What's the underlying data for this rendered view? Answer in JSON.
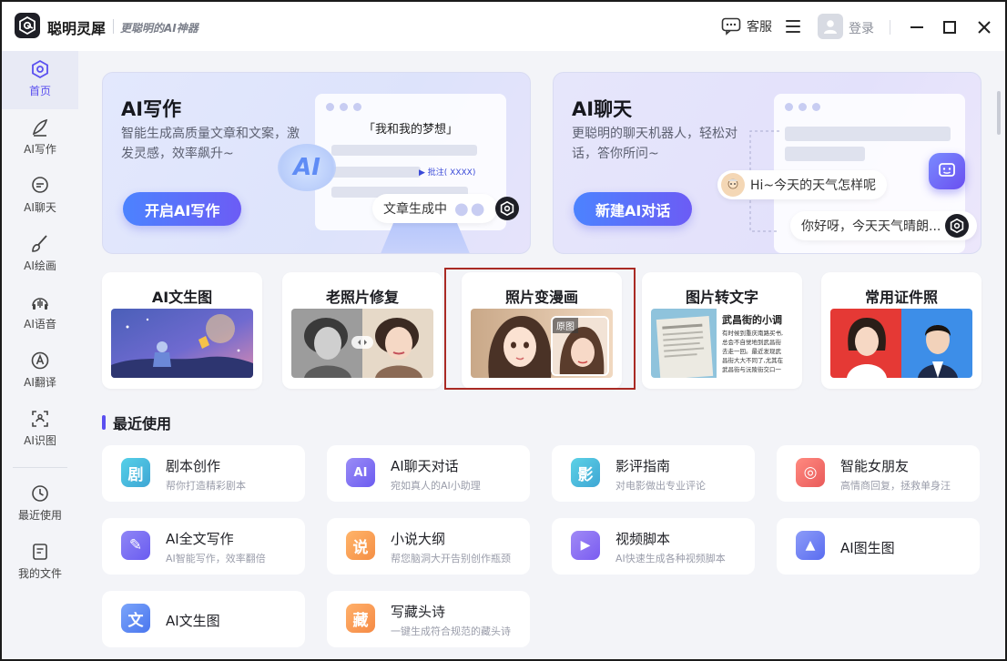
{
  "app": {
    "name": "聪明灵犀",
    "slogan": "更聪明的AI神器",
    "service_label": "客服",
    "login_label": "登录"
  },
  "sidebar": {
    "items": [
      {
        "label": "首页",
        "icon": "home-logo-icon",
        "active": true
      },
      {
        "label": "AI写作",
        "icon": "pen-icon"
      },
      {
        "label": "AI聊天",
        "icon": "chat-icon"
      },
      {
        "label": "AI绘画",
        "icon": "brush-icon"
      },
      {
        "label": "AI语音",
        "icon": "voice-icon"
      },
      {
        "label": "AI翻译",
        "icon": "translate-icon"
      },
      {
        "label": "AI识图",
        "icon": "scan-icon"
      },
      {
        "label": "最近使用",
        "icon": "clock-icon"
      },
      {
        "label": "我的文件",
        "icon": "file-icon"
      }
    ]
  },
  "hero_write": {
    "title": "AI写作",
    "desc": "智能生成高质量文章和文案，激发灵感，效率飙升~",
    "button": "开启AI写作",
    "mock_heading": "「我和我的梦想」",
    "mock_note": "▶ 批注( XXXX)",
    "ai_badge": "AI",
    "status_bubble": "文章生成中"
  },
  "hero_chat": {
    "title": "AI聊天",
    "desc": "更聪明的聊天机器人，轻松对话，答你所问~",
    "button": "新建AI对话",
    "user_bubble": "Hi~今天的天气怎样呢",
    "bot_bubble": "你好呀，今天天气晴朗..."
  },
  "features": [
    {
      "title": "AI文生图"
    },
    {
      "title": "老照片修复"
    },
    {
      "title": "照片变漫画",
      "tag": "原图"
    },
    {
      "title": "图片转文字",
      "book_title": "武昌街的小调",
      "doc_lines": [
        "有时候到重庆南路买书,",
        "总会不自觉地到武昌街",
        "去走一回。最近发现武",
        "昌街大大不同了,尤其在",
        "武昌街与沅陵街交口一"
      ]
    },
    {
      "title": "常用证件照"
    }
  ],
  "recent": {
    "title": "最近使用",
    "items": [
      {
        "title": "剧本创作",
        "sub": "帮你打造精彩剧本",
        "glyph": "剧",
        "color": "#3fb6d8"
      },
      {
        "title": "AI聊天对话",
        "sub": "宛如真人的AI小助理",
        "glyph": "AI",
        "color": "#7b6cf2"
      },
      {
        "title": "影评指南",
        "sub": "对电影做出专业评论",
        "glyph": "影",
        "color": "#3fb2d2"
      },
      {
        "title": "智能女朋友",
        "sub": "高情商回复，拯救单身汪",
        "glyph": "◎",
        "color": "#f07070"
      },
      {
        "title": "AI全文写作",
        "sub": "AI智能写作，效率翻倍",
        "glyph": "✎",
        "color": "#7e72ef"
      },
      {
        "title": "小说大纲",
        "sub": "帮您脑洞大开告别创作瓶颈",
        "glyph": "说",
        "color": "#f5a25a"
      },
      {
        "title": "视频脚本",
        "sub": "AI快速生成各种视频脚本",
        "glyph": "▶",
        "color": "#8a6cf2"
      },
      {
        "title": "AI图生图",
        "sub": "",
        "glyph": "▲",
        "color": "#6a7cf2"
      },
      {
        "title": "AI文生图",
        "sub": "",
        "glyph": "文",
        "color": "#5a86f2"
      },
      {
        "title": "写藏头诗",
        "sub": "一键生成符合规范的藏头诗",
        "glyph": "藏",
        "color": "#f59a55"
      }
    ]
  }
}
